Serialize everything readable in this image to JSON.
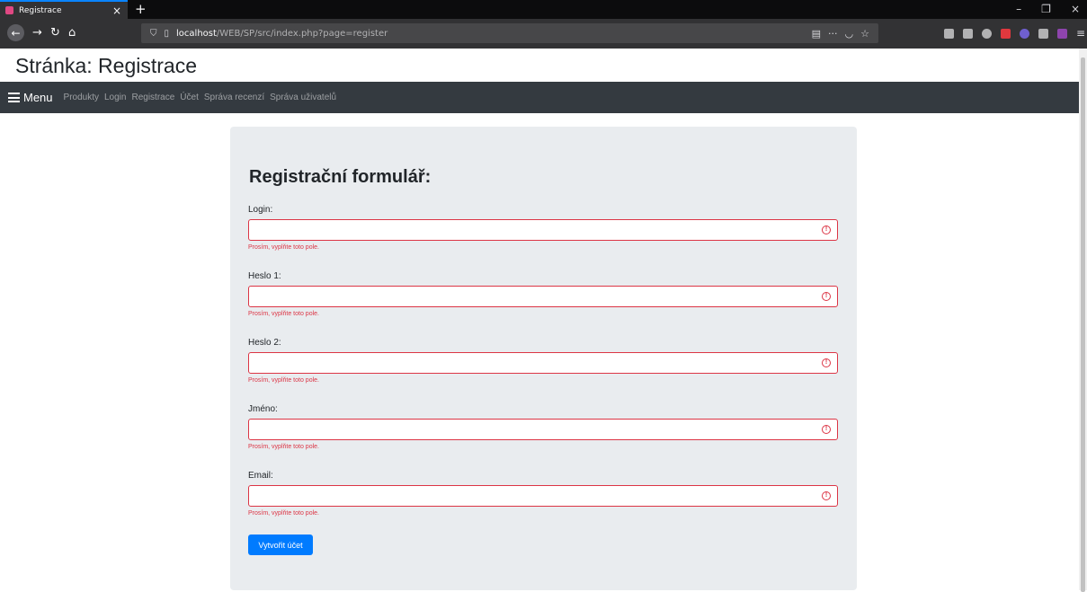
{
  "browser": {
    "tab_title": "Registrace",
    "tab_close": "×",
    "new_tab": "+",
    "url_host": "localhost",
    "url_path": "/WEB/SP/src/index.php?page=register",
    "window_controls": [
      "–",
      "❐",
      "×"
    ]
  },
  "page": {
    "title": "Stránka: Registrace"
  },
  "nav": {
    "menu_label": "Menu",
    "links": [
      "Produkty",
      "Login",
      "Registrace",
      "Účet",
      "Správa recenzí",
      "Správa uživatelů"
    ]
  },
  "form": {
    "title": "Registrační formulář:",
    "fields": [
      {
        "label": "Login:",
        "value": "",
        "error": "Prosím, vyplňte toto pole."
      },
      {
        "label": "Heslo 1:",
        "value": "",
        "error": "Prosím, vyplňte toto pole."
      },
      {
        "label": "Heslo 2:",
        "value": "",
        "error": "Prosím, vyplňte toto pole."
      },
      {
        "label": "Jméno:",
        "value": "",
        "error": "Prosím, vyplňte toto pole."
      },
      {
        "label": "Email:",
        "value": "",
        "error": "Prosím, vyplňte toto pole."
      }
    ],
    "submit_label": "Vytvořit účet"
  },
  "colors": {
    "accent": "#007bff",
    "error": "#dc3545",
    "navbar": "#343a40",
    "card": "#e9ecef"
  }
}
